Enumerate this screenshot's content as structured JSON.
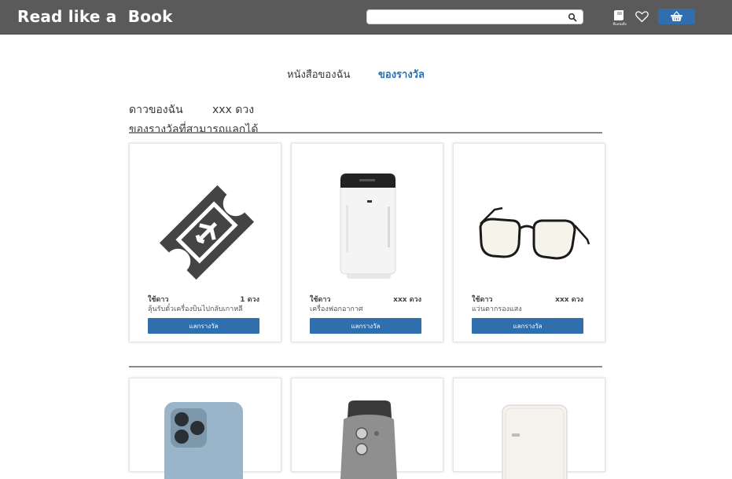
{
  "header": {
    "logo": "Read like a  Book",
    "search": {
      "value": "",
      "placeholder": ""
    },
    "book_label": "ชั้นหนังสือ"
  },
  "tabs": [
    {
      "label": "หนังสือของฉัน",
      "active": false
    },
    {
      "label": "ของรางวัล",
      "active": true
    }
  ],
  "stars": {
    "label": "ดาวของฉัน",
    "value": "xxx  ดวง"
  },
  "section_title": "ของรางวัลที่สามารถแลกได้",
  "rewards": [
    {
      "use_label": "ใช้ดาว",
      "cost": "1  ดวง",
      "name": "ลุ้นรับตั๋วเครื่องบินไปกลับเกาหลี",
      "button": "แลกรางวัล",
      "icon": "plane-ticket-icon"
    },
    {
      "use_label": "ใช้ดาว",
      "cost": "xxx  ดวง",
      "name": "เครื่องฟอกอากาศ",
      "button": "แลกรางวัล",
      "icon": "air-purifier-icon"
    },
    {
      "use_label": "ใช้ดาว",
      "cost": "xxx  ดวง",
      "name": "แว่นตากรองแสง",
      "button": "แลกรางวัล",
      "icon": "glasses-icon"
    }
  ],
  "more_rewards": [
    {
      "icon": "smartphone-icon"
    },
    {
      "icon": "air-fryer-icon"
    },
    {
      "icon": "mini-fridge-icon"
    }
  ],
  "colors": {
    "navbar": "#5a5a5a",
    "accent": "#2f6fad",
    "divider": "#8a8a8a"
  }
}
